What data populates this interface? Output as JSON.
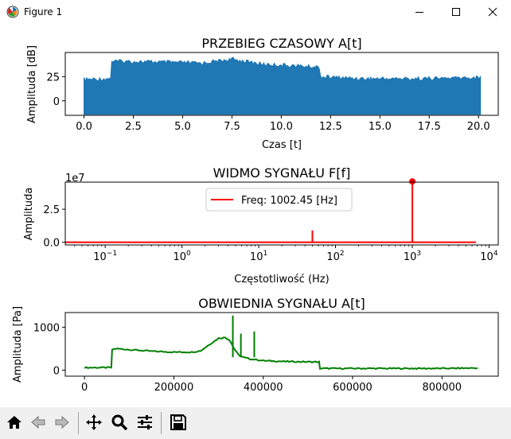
{
  "window": {
    "title": "Figure 1"
  },
  "icons": {
    "app": "matplotlib-icon",
    "minimize": "minimize-icon",
    "maximize": "maximize-icon",
    "close": "close-icon",
    "home": "home-icon",
    "back": "back-arrow-icon",
    "forward": "forward-arrow-icon",
    "pan": "pan-move-icon",
    "zoom": "zoom-magnifier-icon",
    "configure": "configure-subplots-icon",
    "save": "save-disk-icon"
  },
  "chart_data": [
    {
      "type": "area",
      "title": "PRZEBIEG CZASOWY A[t]",
      "xlabel": "Czas [t]",
      "ylabel": "Amplituda [dB]",
      "xlim": [
        -0.95,
        21.0
      ],
      "ylim": [
        -15,
        50
      ],
      "xticks": [
        "0.0",
        "2.5",
        "5.0",
        "7.5",
        "10.0",
        "12.5",
        "15.0",
        "17.5",
        "20.0"
      ],
      "yticks": [
        "0",
        "25"
      ],
      "color": "#1f77b4",
      "series": [
        {
          "x": [
            0,
            1.4,
            1.4,
            4,
            6,
            7.5,
            9,
            11.95,
            11.95,
            14,
            17,
            20.1
          ],
          "upper": [
            24,
            25,
            43,
            42,
            41,
            45,
            40,
            37,
            27,
            25,
            25,
            26
          ],
          "lower": [
            -14,
            -14,
            -14,
            -14,
            -14,
            -14,
            -14,
            -14,
            -14,
            -14,
            -14,
            -14
          ]
        }
      ]
    },
    {
      "type": "line",
      "title": "WIDMO SYGNAŁU F[f]",
      "xlabel": "Częstotliwość (Hz)",
      "ylabel": "Amplituda",
      "offset_label": "1e7",
      "xscale": "log",
      "xlim": [
        0.0302,
        13182
      ],
      "ylim": [
        -0.2,
        4.55
      ],
      "xticks": [
        {
          "base": "10",
          "exp": "−1",
          "v": 0.1
        },
        {
          "base": "10",
          "exp": "0",
          "v": 1
        },
        {
          "base": "10",
          "exp": "1",
          "v": 10
        },
        {
          "base": "10",
          "exp": "2",
          "v": 100
        },
        {
          "base": "10",
          "exp": "3",
          "v": 1000
        },
        {
          "base": "10",
          "exp": "4",
          "v": 10000
        }
      ],
      "yticks": [
        "0.0",
        "2.5"
      ],
      "color": "#ff0000",
      "legend": {
        "label": "Freq: 1002.45 [Hz]",
        "position": "upper center"
      },
      "peaks": [
        {
          "x": 50,
          "y": 0.9
        },
        {
          "x": 1002.45,
          "y": 4.6
        }
      ],
      "marker": {
        "x": 1002.45,
        "y": 4.6
      }
    },
    {
      "type": "line",
      "title": "OBWIEDNIA SYGNAŁU A[t]",
      "xlabel": "",
      "ylabel": "Amplituda [Pa]",
      "xlim": [
        -43000,
        926000
      ],
      "ylim": [
        -140,
        1340
      ],
      "xticks": [
        "0",
        "200000",
        "400000",
        "600000",
        "800000"
      ],
      "yticks": [
        "0",
        "1000"
      ],
      "color": "#008000",
      "series": [
        {
          "x": [
            0,
            60000,
            62000,
            70000,
            150000,
            200000,
            240000,
            260000,
            280000,
            300000,
            315000,
            325000,
            335000,
            345000,
            355000,
            370000,
            380000,
            400000,
            450000,
            525000,
            527000,
            600000,
            700000,
            800000,
            880000
          ],
          "y": [
            60,
            60,
            480,
            500,
            440,
            420,
            420,
            450,
            600,
            740,
            760,
            700,
            500,
            350,
            300,
            260,
            250,
            220,
            200,
            190,
            40,
            40,
            40,
            40,
            50
          ]
        }
      ],
      "spikes": [
        {
          "x": 332000,
          "y": 1270
        },
        {
          "x": 350000,
          "y": 850
        },
        {
          "x": 380000,
          "y": 900
        }
      ]
    }
  ]
}
